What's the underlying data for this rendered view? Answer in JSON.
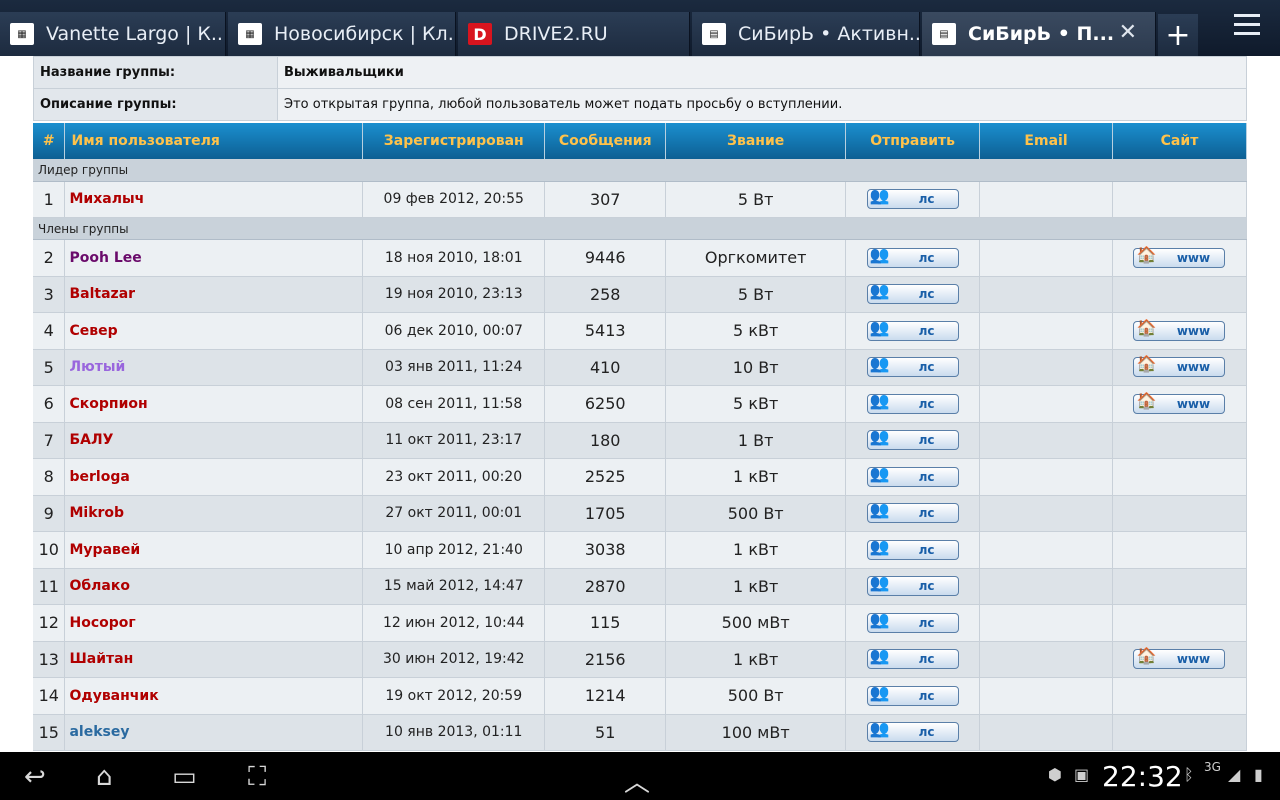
{
  "browser": {
    "tabs": [
      {
        "title": "Vanette Largo | К...",
        "icon": "site-favicon",
        "active": false
      },
      {
        "title": "Новосибирск | Кл...",
        "icon": "site-favicon",
        "active": false
      },
      {
        "title": "DRIVE2.RU",
        "icon": "drive2-favicon",
        "icon_text": "D",
        "active": false
      },
      {
        "title": "СиБирЬ • Активн...",
        "icon": "forum-favicon",
        "active": false
      },
      {
        "title": "СиБирЬ • П...",
        "icon": "forum-favicon",
        "active": true
      }
    ],
    "close_glyph": "✕",
    "new_tab_glyph": "+"
  },
  "group": {
    "name_label": "Название группы:",
    "name_value": "Выживальщики",
    "desc_label": "Описание группы:",
    "desc_value": "Это открытая группа, любой пользователь может подать просьбу о вступлении."
  },
  "table": {
    "headers": {
      "num": "#",
      "user": "Имя пользователя",
      "registered": "Зарегистрирован",
      "posts": "Сообщения",
      "rank": "Звание",
      "send": "Отправить",
      "email": "Email",
      "site": "Сайт"
    },
    "leader_section": "Лидер группы",
    "members_section": "Члены группы",
    "pm_label": "лс",
    "www_label": "www",
    "leaders": [
      {
        "n": "1",
        "name": "Михалыч",
        "color": "#b00000",
        "date": "09 фев 2012, 20:55",
        "posts": "307",
        "rank": "5 Вт",
        "www": false
      }
    ],
    "members": [
      {
        "n": "2",
        "name": "Pooh Lee",
        "color": "#6a0a6a",
        "date": "18 ноя 2010, 18:01",
        "posts": "9446",
        "rank": "Оргкомитет",
        "www": true
      },
      {
        "n": "3",
        "name": "Baltazar",
        "color": "#b00000",
        "date": "19 ноя 2010, 23:13",
        "posts": "258",
        "rank": "5 Вт",
        "www": false
      },
      {
        "n": "4",
        "name": "Север",
        "color": "#b00000",
        "date": "06 дек 2010, 00:07",
        "posts": "5413",
        "rank": "5 кВт",
        "www": true
      },
      {
        "n": "5",
        "name": "Лютый",
        "color": "#9966dd",
        "date": "03 янв 2011, 11:24",
        "posts": "410",
        "rank": "10 Вт",
        "www": true
      },
      {
        "n": "6",
        "name": "Скорпион",
        "color": "#b00000",
        "date": "08 сен 2011, 11:58",
        "posts": "6250",
        "rank": "5 кВт",
        "www": true
      },
      {
        "n": "7",
        "name": "БАЛУ",
        "color": "#b00000",
        "date": "11 окт 2011, 23:17",
        "posts": "180",
        "rank": "1 Вт",
        "www": false
      },
      {
        "n": "8",
        "name": "berloga",
        "color": "#b00000",
        "date": "23 окт 2011, 00:20",
        "posts": "2525",
        "rank": "1 кВт",
        "www": false
      },
      {
        "n": "9",
        "name": "Mikrob",
        "color": "#b00000",
        "date": "27 окт 2011, 00:01",
        "posts": "1705",
        "rank": "500 Вт",
        "www": false
      },
      {
        "n": "10",
        "name": "Муравей",
        "color": "#b00000",
        "date": "10 апр 2012, 21:40",
        "posts": "3038",
        "rank": "1 кВт",
        "www": false
      },
      {
        "n": "11",
        "name": "Облако",
        "color": "#b00000",
        "date": "15 май 2012, 14:47",
        "posts": "2870",
        "rank": "1 кВт",
        "www": false
      },
      {
        "n": "12",
        "name": "Носорог",
        "color": "#b00000",
        "date": "12 июн 2012, 10:44",
        "posts": "115",
        "rank": "500 мВт",
        "www": false
      },
      {
        "n": "13",
        "name": "Шайтан",
        "color": "#b00000",
        "date": "30 июн 2012, 19:42",
        "posts": "2156",
        "rank": "1 кВт",
        "www": true
      },
      {
        "n": "14",
        "name": "Одуванчик",
        "color": "#b00000",
        "date": "19 окт 2012, 20:59",
        "posts": "1214",
        "rank": "500 Вт",
        "www": false
      },
      {
        "n": "15",
        "name": "aleksey",
        "color": "#2a6aa0",
        "date": "10 янв 2013, 01:11",
        "posts": "51",
        "rank": "100 мВт",
        "www": false
      }
    ]
  },
  "statusbar": {
    "time": "22:32",
    "network": "3G"
  }
}
